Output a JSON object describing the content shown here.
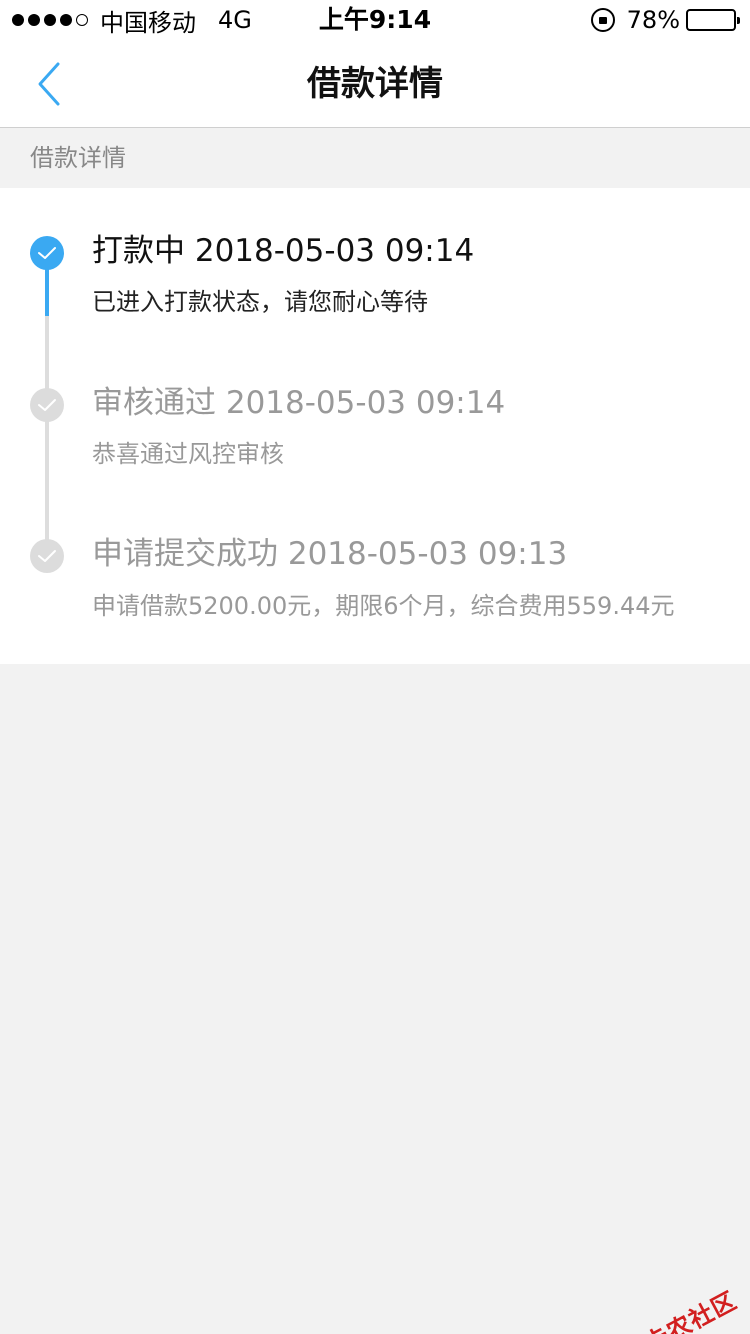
{
  "status_bar": {
    "carrier": "中国移动",
    "network": "4G",
    "time": "上午9:14",
    "battery": "78%",
    "battery_level": 0.78
  },
  "nav": {
    "title": "借款详情"
  },
  "section": {
    "header": "借款详情"
  },
  "timeline": {
    "steps": [
      {
        "title": "打款中 2018-05-03 09:14",
        "desc": "已进入打款状态，请您耐心等待",
        "state": "active"
      },
      {
        "title": "审核通过 2018-05-03 09:14",
        "desc": "恭喜通过风控审核",
        "state": "done"
      },
      {
        "title": "申请提交成功 2018-05-03 09:13",
        "desc": "申请借款5200.00元，期限6个月，综合费用559.44元",
        "state": "done"
      }
    ]
  },
  "watermark": {
    "text": "卡农社区"
  },
  "colors": {
    "accent": "#3aa9f2",
    "inactive": "#dcdcdc",
    "background": "#f2f2f2",
    "watermark": "#d21f1f"
  }
}
